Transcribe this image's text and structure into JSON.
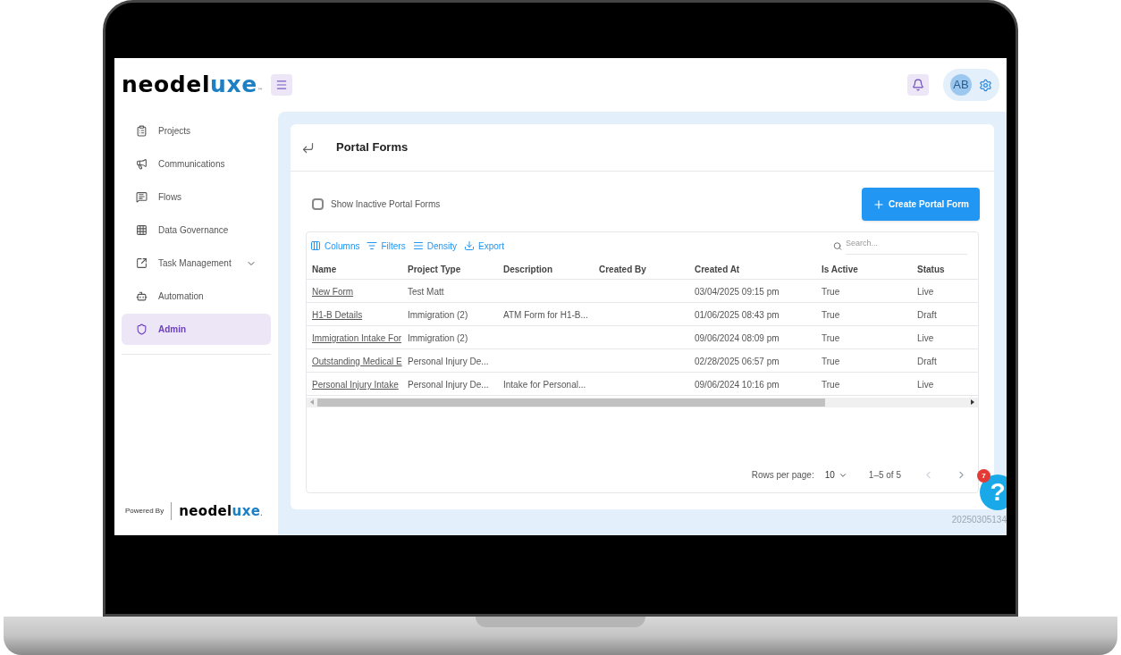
{
  "logo": {
    "main": "neodel",
    "accent": "uxe",
    "tm": "™"
  },
  "header": {
    "avatar": "AB"
  },
  "sidebar": {
    "items": [
      {
        "label": "Projects",
        "selected": false,
        "expandable": false
      },
      {
        "label": "Communications",
        "selected": false,
        "expandable": false
      },
      {
        "label": "Flows",
        "selected": false,
        "expandable": false
      },
      {
        "label": "Data Governance",
        "selected": false,
        "expandable": false
      },
      {
        "label": "Task Management",
        "selected": false,
        "expandable": true
      },
      {
        "label": "Automation",
        "selected": false,
        "expandable": false
      },
      {
        "label": "Admin",
        "selected": true,
        "expandable": false
      }
    ],
    "powered_by": "Powered By",
    "footer_logo": {
      "main": "neodel",
      "accent": "uxe",
      "tm": "."
    }
  },
  "page": {
    "title": "Portal Forms",
    "show_inactive": {
      "label": "Show Inactive Portal Forms",
      "checked": false
    },
    "create_button": "Create Portal Form"
  },
  "toolbar": [
    {
      "label": "Columns"
    },
    {
      "label": "Filters"
    },
    {
      "label": "Density"
    },
    {
      "label": "Export"
    }
  ],
  "search": {
    "placeholder": "Search..."
  },
  "table": {
    "columns": [
      "Name",
      "Project Type",
      "Description",
      "Created By",
      "Created At",
      "Is Active",
      "Status"
    ],
    "rows": [
      [
        "New Form",
        "Test Matt",
        "",
        "",
        "03/04/2025 09:15 pm",
        "True",
        "Live"
      ],
      [
        "H1-B Details",
        "Immigration (2)",
        "ATM Form for H1-B...",
        "",
        "01/06/2025 08:43 pm",
        "True",
        "Draft"
      ],
      [
        "Immigration Intake For",
        "Immigration (2)",
        "",
        "",
        "09/06/2024 08:09 pm",
        "True",
        "Live"
      ],
      [
        "Outstanding Medical E",
        "Personal Injury De...",
        "",
        "",
        "02/28/2025 06:57 pm",
        "True",
        "Draft"
      ],
      [
        "Personal Injury Intake",
        "Personal Injury De...",
        "Intake for Personal...",
        "",
        "09/06/2024 10:16 pm",
        "True",
        "Live"
      ]
    ]
  },
  "pagination": {
    "rows_label": "Rows per page:",
    "rows_value": "10",
    "range": "1–5 of 5"
  },
  "help": {
    "badge": "7",
    "label": "?"
  },
  "version": "20250305134"
}
